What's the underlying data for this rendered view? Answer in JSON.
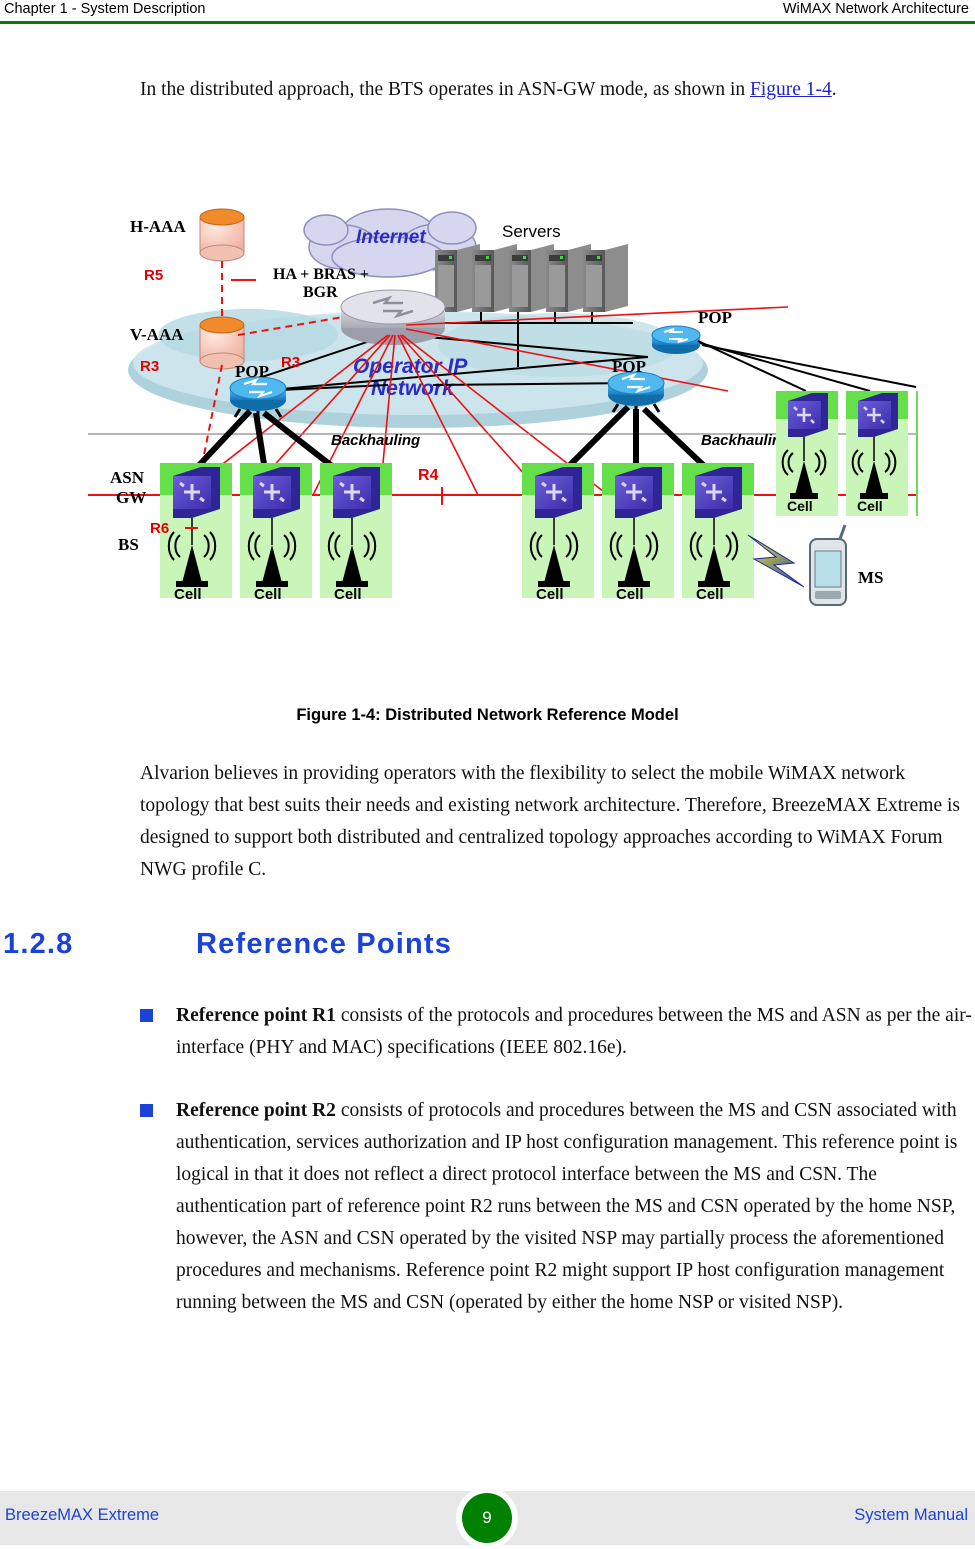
{
  "header": {
    "left": "Chapter 1 - System Description",
    "right": "WiMAX Network Architecture",
    "rule_color": "#0a7a0a"
  },
  "intro": {
    "text_before_link": "In the distributed approach, the BTS operates in ASN-GW mode, as shown in ",
    "link_text": "Figure 1-4",
    "text_after_link": "."
  },
  "figure": {
    "caption": "Figure 1-4: Distributed Network Reference Model",
    "labels": {
      "h_aaa": "H-AAA",
      "v_aaa": "V-AAA",
      "ha_bras_bgr": "HA + BRAS + BGR",
      "internet": "Internet",
      "servers": "Servers",
      "operator_ip_network_line1": "Operator IP",
      "operator_ip_network_line2": "Network",
      "pop_left": "POP",
      "pop_center": "POP",
      "pop_right": "POP",
      "backhauling_left": "Backhauling",
      "backhauling_right": "Backhauling",
      "asn_gw_line1": "ASN",
      "asn_gw_line2": "GW",
      "bs": "BS",
      "ms": "MS",
      "cell": "Cell"
    },
    "reference_points": {
      "r5": "R5",
      "r3_left": "R3",
      "r3_center": "R3",
      "r4": "R4",
      "r6": "R6"
    },
    "colors": {
      "reference_label": "#e00000",
      "reference_line": "#ee1111",
      "cell_box": "#66e04a",
      "asn_gw_switch": "#4b3fc4",
      "pop_router": "#2196d8",
      "cloud": "#9ec6d8",
      "internet_cloud": "#c8c8e6",
      "operator_text": "#2020c0",
      "aaa_top": "#f08a2a"
    },
    "cell_count_left_group": 6,
    "cell_count_right_group": 3,
    "server_count": 5
  },
  "after_figure": {
    "paragraph": "Alvarion believes in providing operators with the flexibility to select the mobile WiMAX network topology that best suits their needs and existing network architecture. Therefore, BreezeMAX Extreme is designed to support both distributed and centralized topology approaches according to WiMAX Forum NWG profile C."
  },
  "section": {
    "number": "1.2.8",
    "title": "Reference Points",
    "color": "#1b43d8"
  },
  "bullets": [
    {
      "lead": "Reference point R1",
      "body": " consists of the protocols and procedures between the MS and ASN as per the air-interface (PHY and MAC) specifications (IEEE 802.16e)."
    },
    {
      "lead": "Reference point R2",
      "body": " consists of protocols and procedures between the MS and CSN associated with authentication, services authorization and IP host configuration management. This reference point is logical in that it does not reflect a direct protocol interface between the MS and CSN. The authentication part of reference point R2 runs between the MS and CSN operated by the home NSP, however, the ASN and CSN operated by the visited NSP may partially process the aforementioned procedures and mechanisms. Reference point R2 might support IP host configuration management running between the MS and CSN (operated by either the home NSP or visited NSP)."
    }
  ],
  "footer": {
    "left": "BreezeMAX Extreme",
    "page_number": "9",
    "right": "System Manual",
    "band_color": "#e7e7e7",
    "badge_color": "#008000"
  }
}
